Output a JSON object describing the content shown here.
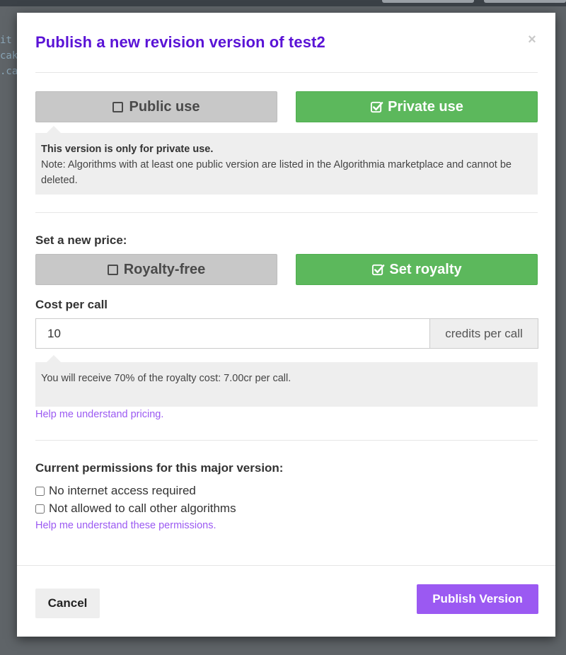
{
  "background": {
    "code_lines": [
      "it",
      "cak",
      ".ca"
    ]
  },
  "modal": {
    "title": "Publish a new revision version of test2",
    "close_symbol": "×"
  },
  "visibility": {
    "public_label": "Public use",
    "private_label": "Private use",
    "selected": "private",
    "info_bold": "This version is only for private use.",
    "info_note": "Note: Algorithms with at least one public version are listed in the Algorithmia marketplace and cannot be deleted."
  },
  "pricing": {
    "heading": "Set a new price:",
    "royalty_free_label": "Royalty-free",
    "set_royalty_label": "Set royalty",
    "selected": "set_royalty",
    "cost_label": "Cost per call",
    "cost_value": "10",
    "cost_unit": "credits per call",
    "royalty_info": "You will receive 70% of the royalty cost: 7.00cr per call.",
    "help_link": "Help me understand pricing."
  },
  "permissions": {
    "heading": "Current permissions for this major version:",
    "items": [
      {
        "label": "No internet access required",
        "checked": false
      },
      {
        "label": "Not allowed to call other algorithms",
        "checked": false
      }
    ],
    "help_link": "Help me understand these permissions."
  },
  "footer": {
    "cancel_label": "Cancel",
    "publish_label": "Publish Version"
  },
  "colors": {
    "title": "#5a13d6",
    "selected_green": "#5cb85c",
    "unselected_gray": "#c8c8c8",
    "accent_purple": "#9b59f2"
  },
  "icons": {
    "unchecked": "square-icon",
    "checked": "check-square-icon",
    "close": "close-icon"
  }
}
